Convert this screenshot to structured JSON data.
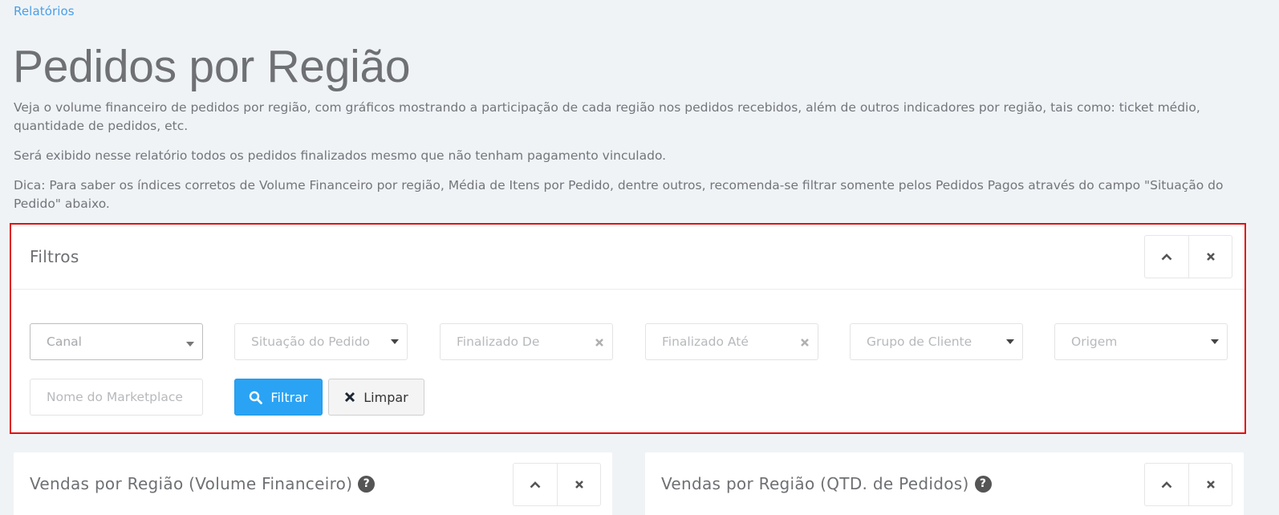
{
  "breadcrumb": "Relatórios",
  "title": "Pedidos por Região",
  "descriptions": {
    "p1": "Veja o volume financeiro de pedidos por região, com gráficos mostrando a participação de cada região nos pedidos recebidos, além de outros indicadores por região, tais como: ticket médio, quantidade de pedidos, etc.",
    "p2": "Será exibido nesse relatório todos os pedidos finalizados mesmo que não tenham pagamento vinculado.",
    "p3": "Dica: Para saber os índices corretos de Volume Financeiro por região, Média de Itens por Pedido, dentre outros, recomenda-se filtrar somente pelos Pedidos Pagos através do campo \"Situação do Pedido\" abaixo."
  },
  "filters": {
    "title": "Filtros",
    "fields": {
      "canal": "Canal",
      "situacao": "Situação do Pedido",
      "finalizado_de": "Finalizado De",
      "finalizado_ate": "Finalizado Até",
      "grupo_cliente": "Grupo de Cliente",
      "origem": "Origem",
      "marketplace": "Nome do Marketplace"
    },
    "buttons": {
      "filter": "Filtrar",
      "clear": "Limpar"
    }
  },
  "cards": {
    "left_title": "Vendas por Região (Volume Financeiro)",
    "right_title": "Vendas por Região (QTD. de Pedidos)",
    "help_glyph": "?"
  },
  "icons": {
    "collapse": "chevron-up-icon",
    "close": "close-icon",
    "search": "search-icon",
    "clear": "times-icon"
  },
  "colors": {
    "accent": "#2aa3f4",
    "link": "#4a9fe6",
    "highlight_border": "#e01010"
  }
}
